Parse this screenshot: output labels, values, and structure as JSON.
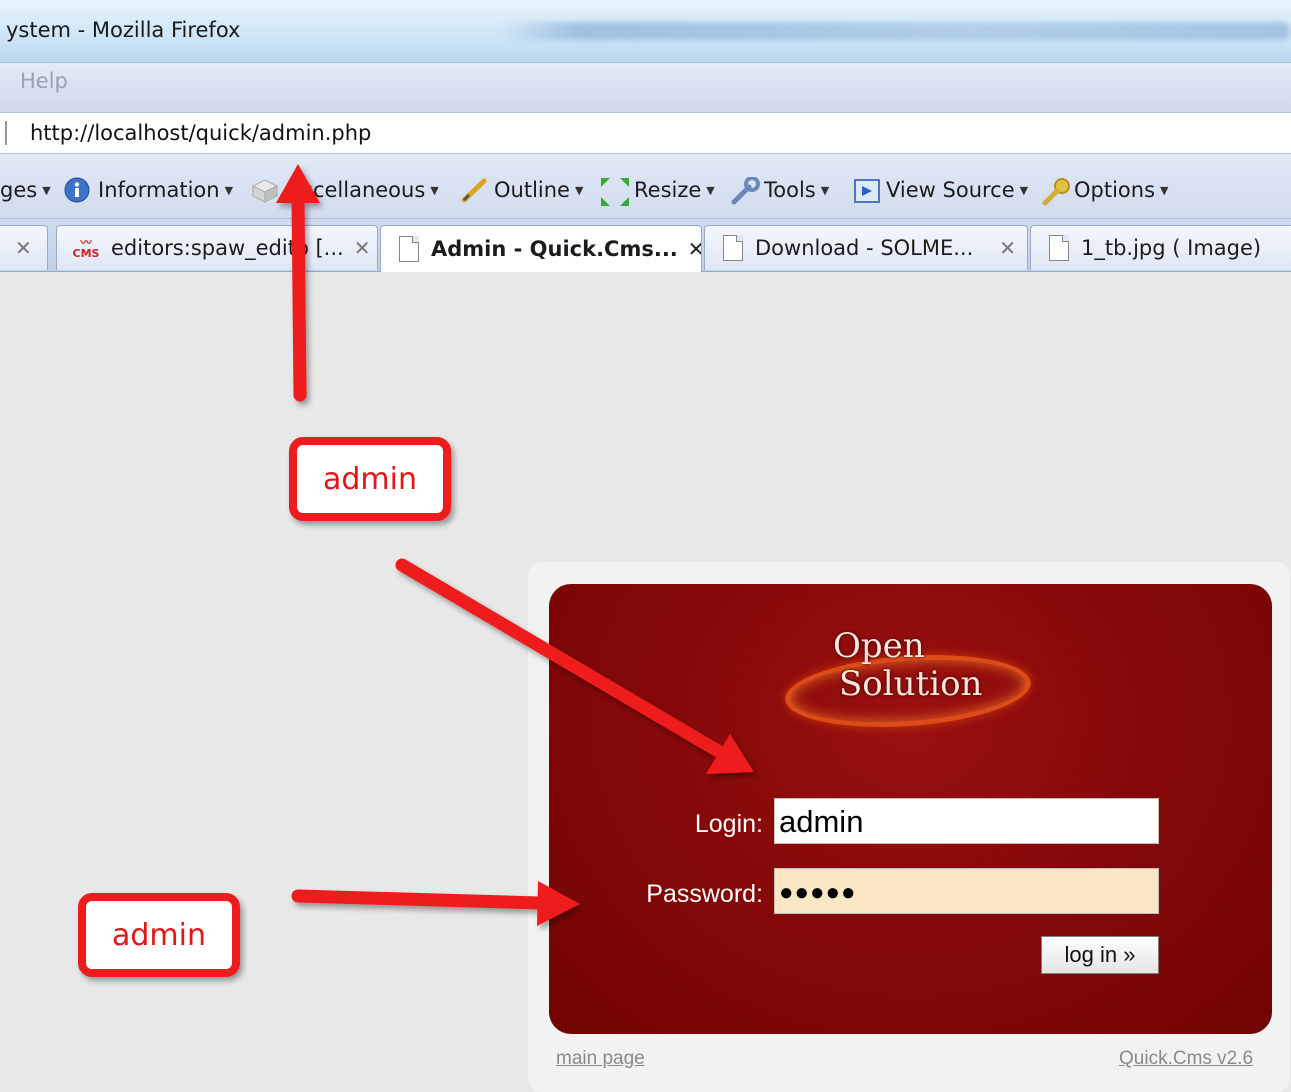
{
  "window": {
    "title": "ystem - Mozilla Firefox"
  },
  "menubar": {
    "help_label": "Help"
  },
  "urlbar": {
    "url": "http://localhost/quick/admin.php"
  },
  "toolbar": {
    "items": [
      {
        "label": "ges",
        "icon": "images-icon"
      },
      {
        "label": "Information",
        "icon": "info-icon"
      },
      {
        "label": "scellaneous",
        "icon": "miscellaneous-icon"
      },
      {
        "label": "Outline",
        "icon": "outline-pen-icon"
      },
      {
        "label": "Resize",
        "icon": "resize-icon"
      },
      {
        "label": "Tools",
        "icon": "wrench-icon"
      },
      {
        "label": "View Source",
        "icon": "view-source-icon"
      },
      {
        "label": "Options",
        "icon": "key-icon"
      }
    ]
  },
  "tabs": [
    {
      "label": "editors:spaw_edito [...",
      "icon": "cms-icon",
      "active": false
    },
    {
      "label": "Admin - Quick.Cms...",
      "icon": "page-icon",
      "active": true
    },
    {
      "label": "Download - SOLME...",
      "icon": "page-icon",
      "active": false
    },
    {
      "label": "1_tb.jpg ( Image)",
      "icon": "page-icon",
      "active": false
    }
  ],
  "logo": {
    "line1": "Open",
    "line2": "Solution"
  },
  "login_form": {
    "login_label": "Login:",
    "login_value": "admin",
    "password_label": "Password:",
    "password_value": "●●●●●",
    "submit_label": "log in »"
  },
  "footer": {
    "main_page_link": "main page",
    "version_link": "Quick.Cms v2.6"
  },
  "annotations": {
    "callout_top": "admin",
    "callout_bottom": "admin",
    "color": "#ee1c1c"
  }
}
